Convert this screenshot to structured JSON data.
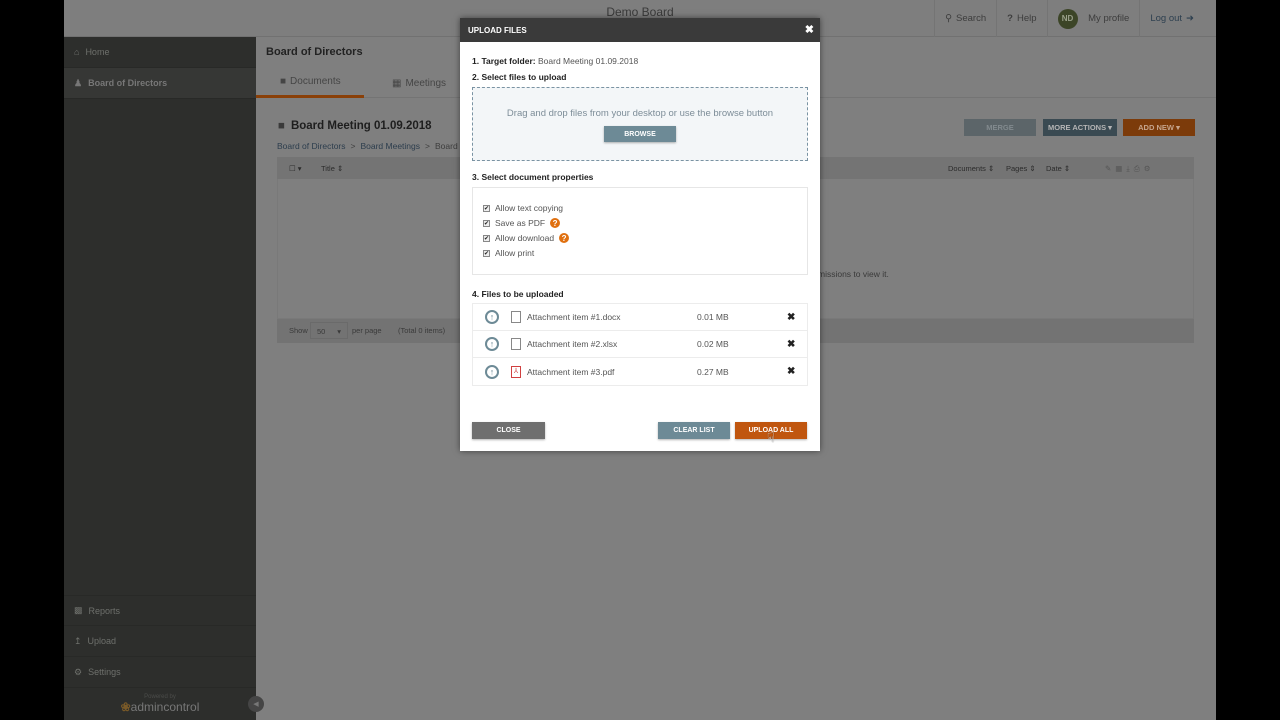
{
  "app": {
    "title": "Demo Board"
  },
  "topnav": {
    "search": "Search",
    "help": "Help",
    "avatar_initials": "ND",
    "profile": "My profile",
    "logout": "Log out"
  },
  "sidebar": {
    "items": [
      {
        "label": "Home",
        "icon": "home-icon"
      },
      {
        "label": "Board of Directors",
        "icon": "users-icon"
      }
    ],
    "bottom_items": [
      {
        "label": "Reports",
        "icon": "bar-chart-icon"
      },
      {
        "label": "Upload",
        "icon": "upload-icon"
      },
      {
        "label": "Settings",
        "icon": "gear-icon"
      }
    ],
    "powered_by": "Powered by",
    "brand": "admincontrol"
  },
  "main": {
    "section_title": "Board of Directors",
    "tabs": [
      {
        "label": "Documents",
        "active": true
      },
      {
        "label": "Meetings",
        "active": false
      }
    ],
    "folder_title": "Board Meeting 01.09.2018",
    "breadcrumb": [
      "Board of Directors",
      "Board Meetings",
      "Board M"
    ],
    "breadcrumb_sep": ">",
    "buttons": {
      "merge": "MERGE",
      "more_actions": "MORE ACTIONS",
      "add_new": "ADD NEW"
    },
    "columns": {
      "title": "Title ⇕",
      "documents": "Documents ⇕",
      "pages": "Pages ⇕",
      "date": "Date ⇕"
    },
    "empty_text": "missions to view it.",
    "footer": {
      "show": "Show",
      "per_page_value": "50",
      "per_page": "per page",
      "total": "(Total 0 items)"
    }
  },
  "modal": {
    "title": "UPLOAD FILES",
    "step1_label": "1. Target folder:",
    "step1_value": "Board Meeting 01.09.2018",
    "step2_label": "2. Select files to upload",
    "drop_text": "Drag and drop files from your desktop or use the browse button",
    "browse": "BROWSE",
    "step3_label": "3. Select document properties",
    "properties": [
      {
        "label": "Allow text copying",
        "checked": true,
        "help": false
      },
      {
        "label": "Save as PDF",
        "checked": true,
        "help": true
      },
      {
        "label": "Allow download",
        "checked": true,
        "help": true
      },
      {
        "label": "Allow print",
        "checked": true,
        "help": false
      }
    ],
    "step4_label": "4. Files to be uploaded",
    "files": [
      {
        "name": "Attachment item #1.docx",
        "size": "0.01 MB",
        "type": "file-icon"
      },
      {
        "name": "Attachment item #2.xlsx",
        "size": "0.02 MB",
        "type": "file-icon"
      },
      {
        "name": "Attachment item #3.pdf",
        "size": "0.27 MB",
        "type": "pdf-icon"
      }
    ],
    "close": "CLOSE",
    "clear_list": "CLEAR LIST",
    "upload_all": "UPLOAD ALL"
  },
  "colors": {
    "accent": "#c0560f",
    "slate": "#6d8a96",
    "header": "#3a3a3a"
  }
}
